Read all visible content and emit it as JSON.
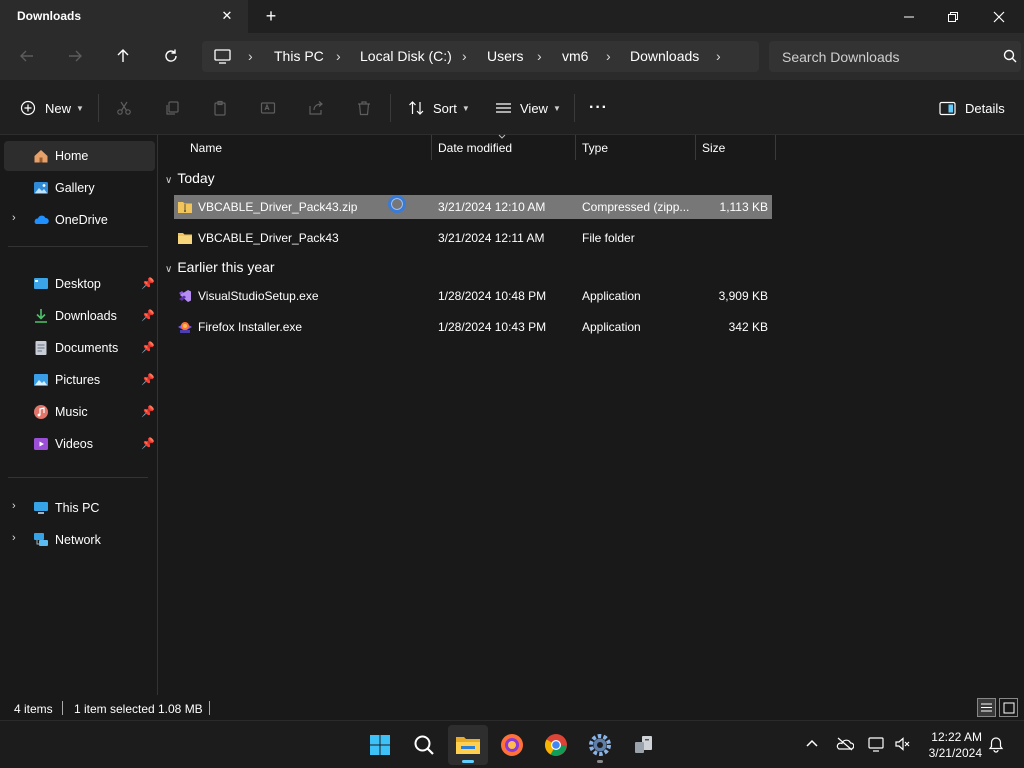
{
  "window": {
    "tab_title": "Downloads",
    "tab_close": "✕",
    "new_tab": "+"
  },
  "nav": {
    "breadcrumbs": [
      "This PC",
      "Local Disk (C:)",
      "Users",
      "vm6",
      "Downloads"
    ],
    "separator": "›",
    "search_placeholder": "Search Downloads"
  },
  "command_bar": {
    "new_label": "New",
    "sort_label": "Sort",
    "view_label": "View",
    "more_label": "···",
    "details_label": "Details"
  },
  "sidebar": {
    "home": "Home",
    "gallery": "Gallery",
    "onedrive": "OneDrive",
    "quick_access": [
      "Desktop",
      "Downloads",
      "Documents",
      "Pictures",
      "Music",
      "Videos"
    ],
    "this_pc": "This PC",
    "network": "Network",
    "pin_glyph": "📌",
    "chevron": "›"
  },
  "columns": {
    "name": "Name",
    "date": "Date modified",
    "type": "Type",
    "size": "Size"
  },
  "groups": {
    "today": "Today",
    "earlier": "Earlier this year"
  },
  "files": [
    {
      "name": "VBCABLE_Driver_Pack43.zip",
      "date": "3/21/2024 12:10 AM",
      "type": "Compressed (zipp...",
      "size": "1,113 KB",
      "icon": "zip-folder-icon",
      "selected": true
    },
    {
      "name": "VBCABLE_Driver_Pack43",
      "date": "3/21/2024 12:11 AM",
      "type": "File folder",
      "size": "",
      "icon": "folder-icon",
      "selected": false
    },
    {
      "name": "VisualStudioSetup.exe",
      "date": "1/28/2024 10:48 PM",
      "type": "Application",
      "size": "3,909 KB",
      "icon": "visual-studio-icon",
      "selected": false
    },
    {
      "name": "Firefox Installer.exe",
      "date": "1/28/2024 10:43 PM",
      "type": "Application",
      "size": "342 KB",
      "icon": "firefox-installer-icon",
      "selected": false
    }
  ],
  "status": {
    "item_count": "4 items",
    "selection": "1 item selected",
    "selection_size": "1.08 MB"
  },
  "taskbar": {
    "time": "12:22 AM",
    "date": "3/21/2024",
    "apps": [
      "start-icon",
      "search-icon",
      "file-explorer-icon",
      "firefox-icon",
      "chrome-icon",
      "settings-icon",
      "network-share-icon"
    ]
  },
  "colors": {
    "background": "#191919",
    "selection": "#777777",
    "accent": "#60cdff"
  }
}
